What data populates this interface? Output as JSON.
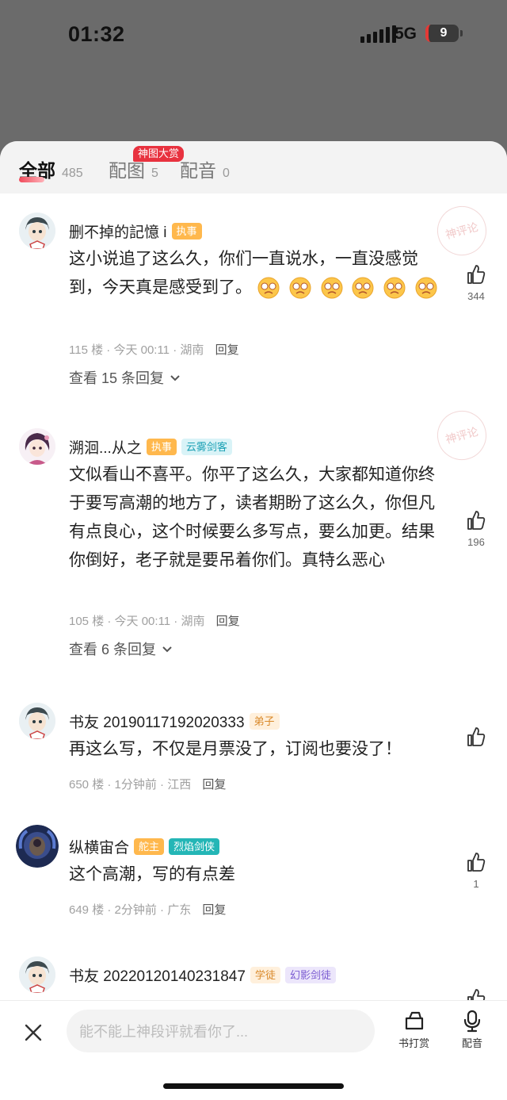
{
  "status": {
    "time": "01:32",
    "network": "5G",
    "battery": "9"
  },
  "tabs": [
    {
      "label": "全部",
      "count": "485"
    },
    {
      "label": "配图",
      "count": "5"
    },
    {
      "label": "配音",
      "count": "0"
    }
  ],
  "promo_badge": "神图大赏",
  "stamp_text": "神评论",
  "comments": [
    {
      "user": "删不掉的記憶 i",
      "badges": [
        "执事"
      ],
      "text": "这小说追了这么久，你们一直说水，一直没感觉到，今天真是感受到了。",
      "floor": "115 楼",
      "time": "今天 00:11",
      "location": "湖南",
      "reply_label": "回复",
      "replies": "查看 15 条回复",
      "likes": "344"
    },
    {
      "user": "溯洄...从之",
      "badges": [
        "执事",
        "云雾剑客"
      ],
      "text": "文似看山不喜平。你平了这么久，大家都知道你终于要写高潮的地方了，读者期盼了这么久，你但凡有点良心，这个时候要么多写点，要么加更。结果你倒好，老子就是要吊着你们。真特么恶心",
      "floor": "105 楼",
      "time": "今天 00:11",
      "location": "湖南",
      "reply_label": "回复",
      "replies": "查看 6 条回复",
      "likes": "196"
    },
    {
      "user": "书友 20190117192020333",
      "badges": [
        "弟子"
      ],
      "text": "再这么写，不仅是月票没了，订阅也要没了！",
      "floor": "650 楼",
      "time": "1分钟前",
      "location": "江西",
      "reply_label": "回复",
      "likes": ""
    },
    {
      "user": "纵横宙合",
      "badges": [
        "舵主",
        "烈焰剑侠"
      ],
      "text": "这个高潮，写的有点差",
      "floor": "649 楼",
      "time": "2分钟前",
      "location": "广东",
      "reply_label": "回复",
      "likes": "1"
    },
    {
      "user": "书友 20220120140231847",
      "badges": [
        "学徒",
        "幻影剑徒"
      ],
      "likes": ""
    }
  ],
  "bottom": {
    "placeholder": "能不能上神段评就看你了...",
    "tip_label": "书打赏",
    "dub_label": "配音"
  }
}
